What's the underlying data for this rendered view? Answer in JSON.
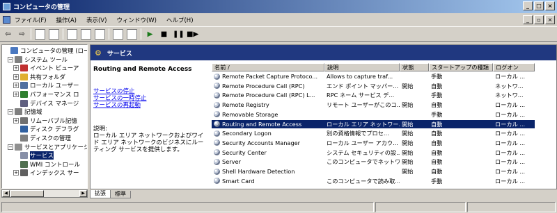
{
  "window": {
    "title": "コンピュータの管理",
    "min": "_",
    "max": "□",
    "close": "×"
  },
  "menu": {
    "items": [
      "ファイル(F)",
      "操作(A)",
      "表示(V)",
      "ウィンドウ(W)",
      "ヘルプ(H)"
    ],
    "mdi_min": "_",
    "mdi_max": "▫",
    "mdi_close": "×"
  },
  "toolbar": {
    "back": "⇦",
    "forward": "⇨",
    "play": "▶",
    "stop": "■",
    "pause": "❚❚",
    "restart": "■▶"
  },
  "tree": {
    "items": [
      {
        "label": "コンピュータの管理 (ロー",
        "expander": "",
        "icon_color": "#4a78c0"
      },
      {
        "label": "システム ツール",
        "expander": "−",
        "icon_color": "#808080"
      },
      {
        "label": "イベント ビューア",
        "expander": "+",
        "icon_color": "#c03030"
      },
      {
        "label": "共有フォルダ",
        "expander": "+",
        "icon_color": "#e0b030"
      },
      {
        "label": "ローカル ユーザー",
        "expander": "+",
        "icon_color": "#5070a0"
      },
      {
        "label": "パフォーマンス ロ",
        "expander": "+",
        "icon_color": "#308030"
      },
      {
        "label": "デバイス マネージ",
        "expander": "",
        "icon_color": "#606080"
      },
      {
        "label": "記憶域",
        "expander": "−",
        "icon_color": "#808080"
      },
      {
        "label": "リムーバブル記憶",
        "expander": "+",
        "icon_color": "#707070"
      },
      {
        "label": "ディスク デフラグ",
        "expander": "",
        "icon_color": "#3060a0"
      },
      {
        "label": "ディスクの管理",
        "expander": "",
        "icon_color": "#808080"
      },
      {
        "label": "サービスとアプリケーシ",
        "expander": "−",
        "icon_color": "#909090"
      },
      {
        "label": "サービス",
        "expander": "",
        "icon_color": "#8890a8",
        "selected": true
      },
      {
        "label": "WMI コントロール",
        "expander": "",
        "icon_color": "#507050"
      },
      {
        "label": "インデックス サー",
        "expander": "+",
        "icon_color": "#606060"
      }
    ]
  },
  "panel": {
    "header": "サービス",
    "extended": {
      "title": "Routing and Remote Access",
      "links": [
        "サービスの停止",
        "サービスの一時停止",
        "サービスの再起動"
      ],
      "desc_label": "説明:",
      "desc": "ローカル エリア ネットワークおよびワイド エリア ネットワークのビジネスにルーティング サービスを提供します。"
    }
  },
  "list": {
    "columns": [
      "名前 /",
      "説明",
      "状態",
      "スタートアップの種類",
      "ログオン"
    ],
    "rows": [
      [
        "Remote Packet Capture Protoco...",
        "Allows to capture traf...",
        "",
        "手動",
        "ローカル ..."
      ],
      [
        "Remote Procedure Call (RPC)",
        "エンド ポイント マッパー...",
        "開始",
        "自動",
        "ネットワ..."
      ],
      [
        "Remote Procedure Call (RPC) L...",
        "RPC ネーム サービス デ...",
        "",
        "手動",
        "ネットワ..."
      ],
      [
        "Remote Registry",
        "リモート ユーザーがこのコ...",
        "開始",
        "自動",
        "ローカル ..."
      ],
      [
        "Removable Storage",
        "",
        "",
        "手動",
        "ローカル ..."
      ],
      [
        "Routing and Remote Access",
        "ローカル エリア ネットワー...",
        "開始",
        "自動",
        "ローカル ..."
      ],
      [
        "Secondary Logon",
        "別の資格情報でプロセ...",
        "開始",
        "自動",
        "ローカル ..."
      ],
      [
        "Security Accounts Manager",
        "ローカル ユーザー アカウ...",
        "開始",
        "自動",
        "ローカル ..."
      ],
      [
        "Security Center",
        "システム セキュリティの設...",
        "開始",
        "自動",
        "ローカル ..."
      ],
      [
        "Server",
        "このコンピュータでネットワ...",
        "開始",
        "自動",
        "ローカル ..."
      ],
      [
        "Shell Hardware Detection",
        "",
        "開始",
        "自動",
        "ローカル ..."
      ],
      [
        "Smart Card",
        "このコンピュータで読み取...",
        "",
        "手動",
        "ローカル ..."
      ]
    ],
    "selected_row": 5
  },
  "tabs": [
    "拡張",
    "標準"
  ]
}
